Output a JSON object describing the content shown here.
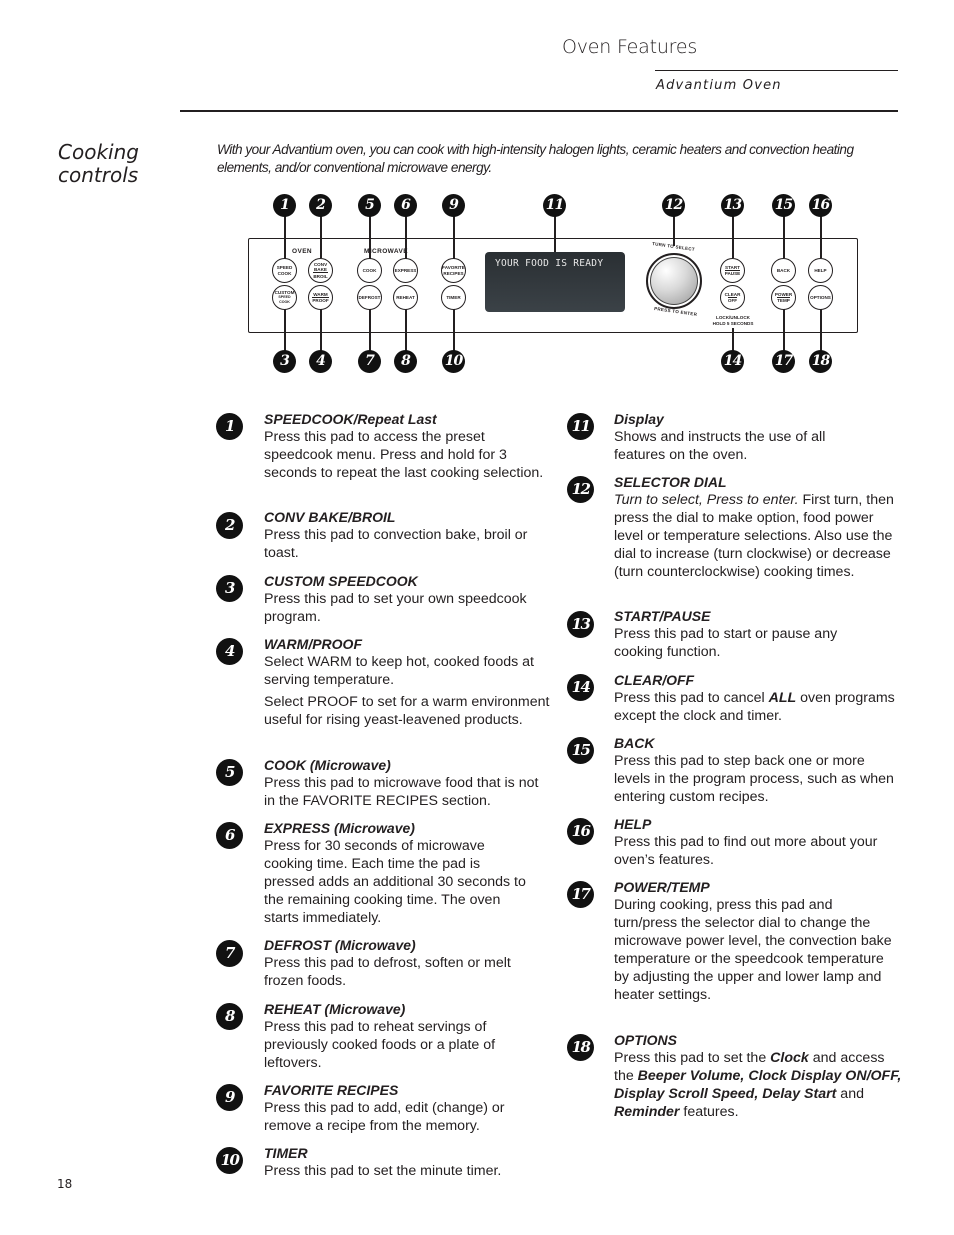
{
  "header": {
    "title": "Oven Features",
    "subtitle": "Advantium Oven"
  },
  "section": {
    "title_line1": "Cooking",
    "title_line2": "controls",
    "intro": "With your Advantium oven, you can cook with high-intensity halogen lights, ceramic heaters and convection heating elements, and/or conventional microwave energy."
  },
  "panel": {
    "group_oven": "OVEN",
    "group_microwave": "MICROWAVE",
    "display_text": "YOUR FOOD IS READY",
    "dial_top": "TURN TO SELECT",
    "dial_bottom": "PRESS TO ENTER",
    "lock_line1": "LOCK/UNLOCK",
    "lock_line2": "HOLD 5 SECONDS",
    "pads": {
      "speedcook": [
        "SPEED",
        "COOK"
      ],
      "convbake": [
        "CONV",
        "BAKE",
        "BROIL"
      ],
      "custom": [
        "CUSTOM",
        "SPEED",
        "COOK"
      ],
      "warm": [
        "WARM",
        "PROOF"
      ],
      "cook": "COOK",
      "express": "EXPRESS",
      "defrost": "DEFROST",
      "reheat": "REHEAT",
      "favorite": [
        "FAVORITE",
        "RECIPES"
      ],
      "timer": "TIMER",
      "start": [
        "START",
        "PAUSE"
      ],
      "clear": [
        "CLEAR",
        "OFF"
      ],
      "back": "BACK",
      "help": "HELP",
      "power": [
        "POWER",
        "TEMP"
      ],
      "options": "OPTIONS"
    },
    "callouts": [
      "1",
      "2",
      "3",
      "4",
      "5",
      "6",
      "7",
      "8",
      "9",
      "10",
      "11",
      "12",
      "13",
      "14",
      "15",
      "16",
      "17",
      "18"
    ]
  },
  "items": [
    {
      "num": "1",
      "title": "SPEEDCOOK/Repeat Last",
      "body": "Press this pad to access the preset speedcook menu. Press and hold for 3 seconds to repeat the last cooking selection."
    },
    {
      "num": "2",
      "title": "CONV BAKE/BROIL",
      "body": "Press this pad to convection bake, broil or toast."
    },
    {
      "num": "3",
      "title": "CUSTOM SPEEDCOOK",
      "body": "Press this pad to set your own speedcook program."
    },
    {
      "num": "4",
      "title": "WARM/PROOF",
      "body": "Select WARM to keep hot, cooked foods at serving temperature.",
      "body2": "Select PROOF to set for a warm environment useful for rising yeast-leavened products."
    },
    {
      "num": "5",
      "title": "COOK (Microwave)",
      "body": "Press this pad to microwave food that is not in the FAVORITE RECIPES section."
    },
    {
      "num": "6",
      "title": "EXPRESS (Microwave)",
      "body": "Press for 30 seconds of microwave cooking time. Each time the pad is pressed adds an additional 30 seconds to the remaining cooking time. The oven starts immediately."
    },
    {
      "num": "7",
      "title": "DEFROST (Microwave)",
      "body": "Press this pad to defrost, soften or melt frozen foods."
    },
    {
      "num": "8",
      "title": "REHEAT (Microwave)",
      "body": "Press this pad to reheat servings of previously cooked foods or a plate of leftovers."
    },
    {
      "num": "9",
      "title": "FAVORITE RECIPES",
      "body": "Press this pad to add, edit (change) or remove a recipe from the memory."
    },
    {
      "num": "10",
      "title": "TIMER",
      "body": "Press this pad to set the minute timer."
    },
    {
      "num": "11",
      "title": "Display",
      "body": "Shows and instructs the use of all features on the oven."
    },
    {
      "num": "12",
      "title": "SELECTOR DIAL",
      "body_italic": "Turn to select, Press to enter.",
      "body": " First turn, then press the dial to make option, food power level or temperature selections. Also use the dial to increase (turn clockwise) or decrease (turn counterclockwise) cooking times."
    },
    {
      "num": "13",
      "title": "START/PAUSE",
      "body": "Press this pad to start or pause any cooking function."
    },
    {
      "num": "14",
      "title": "CLEAR/OFF",
      "body_pre": "Press this pad to cancel ",
      "body_bold": "ALL",
      "body": " oven programs except the clock and timer."
    },
    {
      "num": "15",
      "title": "BACK",
      "body": "Press this pad to step back one or more levels in the program process, such as when entering custom recipes."
    },
    {
      "num": "16",
      "title": "HELP",
      "body": "Press this pad to find out more about your oven’s features."
    },
    {
      "num": "17",
      "title": "POWER/TEMP",
      "body": "During cooking, press this pad and turn/press the selector dial to change the microwave power level, the convection bake temperature or the speedcook temperature by adjusting the upper and lower lamp and heater settings."
    },
    {
      "num": "18",
      "title": "OPTIONS",
      "parts": [
        "Press this pad to set the ",
        "Clock",
        " and access the ",
        "Beeper Volume, Clock Display ON/OFF, Display Scroll Speed, Delay Start",
        " and ",
        "Reminder",
        "  features."
      ]
    }
  ],
  "footer": {
    "page_number": "18"
  }
}
